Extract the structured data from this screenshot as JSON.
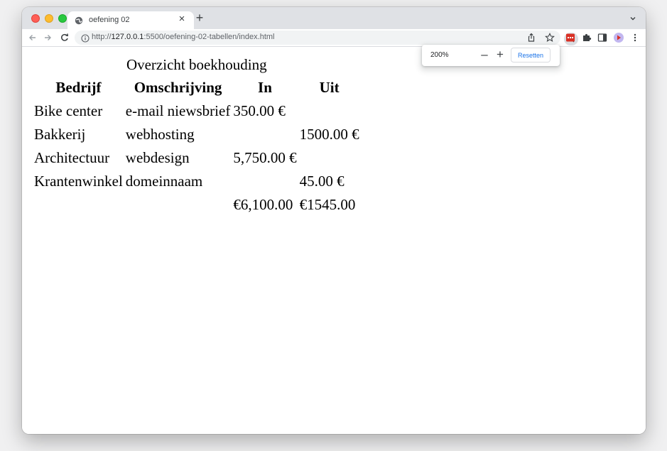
{
  "browser": {
    "tab_title": "oefening 02",
    "tab_close": "×",
    "new_tab": "+",
    "url_prefix": "http://",
    "url_host": "127.0.0.1",
    "url_path": ":5500/oefening-02-tabellen/index.html",
    "icons": [
      "globe-icon",
      "chevron-down-icon",
      "back-arrow-icon",
      "forward-arrow-icon",
      "reload-icon",
      "info-icon",
      "zoom-icon",
      "share-icon",
      "star-icon",
      "extension-badge-icon",
      "puzzle-icon",
      "sidepanel-icon",
      "profile-avatar-icon",
      "kebab-menu-icon"
    ],
    "accent_color": "#1a73e8"
  },
  "zoom_popup": {
    "level": "200%",
    "minus": "–",
    "plus": "+",
    "reset_label": "Resetten"
  },
  "table": {
    "caption": "Overzicht boekhouding",
    "headers": [
      "Bedrijf",
      "Omschrijving",
      "In",
      "Uit"
    ],
    "rows": [
      [
        "Bike center",
        "e-mail niewsbrief",
        "350.00 €",
        ""
      ],
      [
        "Bakkerij",
        "webhosting",
        "",
        "1500.00 €"
      ],
      [
        "Architectuur",
        "webdesign",
        "5,750.00 €",
        ""
      ],
      [
        "Krantenwinkel",
        "domeinnaam",
        "",
        "45.00 €"
      ],
      [
        "",
        "",
        "€6,100.00",
        "€1545.00"
      ]
    ]
  }
}
